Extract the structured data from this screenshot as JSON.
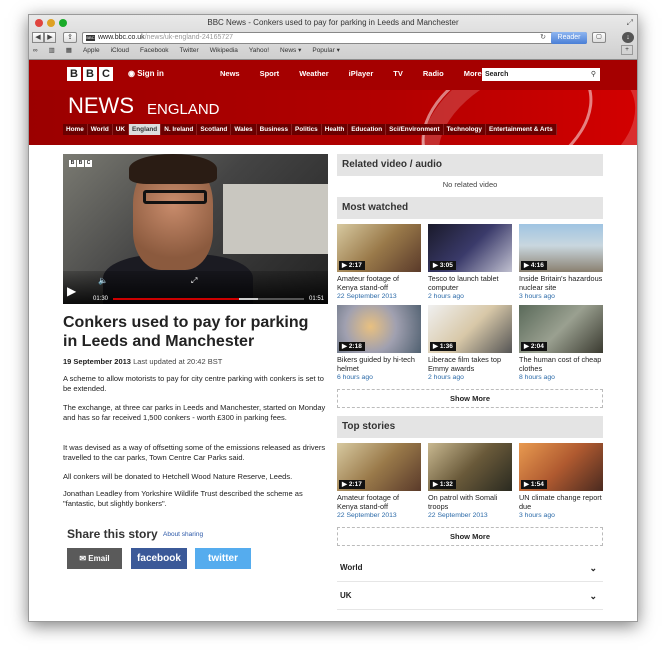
{
  "window": {
    "title": "BBC News - Conkers used to pay for parking in Leeds and Manchester"
  },
  "browser": {
    "url_main": "www.bbc.co.uk",
    "url_path": "/news/uk-england-24165727",
    "reader": "Reader",
    "bookmarks": [
      "Apple",
      "iCloud",
      "Facebook",
      "Twitter",
      "Wikipedia",
      "Yahoo!",
      "News ▾",
      "Popular ▾"
    ]
  },
  "bbc": {
    "logo": [
      "B",
      "B",
      "C"
    ],
    "sign_in": "Sign in",
    "top_nav": [
      "News",
      "Sport",
      "Weather",
      "iPlayer",
      "TV",
      "Radio",
      "More..."
    ],
    "search_placeholder": "Search"
  },
  "banner": {
    "news": "NEWS",
    "region": "ENGLAND"
  },
  "category_nav": [
    "Home",
    "World",
    "UK",
    "England",
    "N. Ireland",
    "Scotland",
    "Wales",
    "Business",
    "Politics",
    "Health",
    "Education",
    "Sci/Environment",
    "Technology",
    "Entertainment & Arts"
  ],
  "video": {
    "elapsed": "01:30",
    "duration": "01:51",
    "progress": 0.66
  },
  "article": {
    "headline": "Conkers used to pay for parking in Leeds and Manchester",
    "date": "19 September 2013",
    "updated": "Last updated at 20:42 BST",
    "paragraphs": [
      "A scheme to allow motorists to pay for city centre parking with conkers is set to be extended.",
      "The exchange, at three car parks in Leeds and Manchester, started on Monday and has so far received 1,500 conkers - worth £300 in parking fees.",
      "It was devised as a way of offsetting some of the emissions released as drivers travelled to the car parks, Town Centre Car Parks said.",
      "All conkers will be donated to Hetchell Wood Nature Reserve, Leeds.",
      "Jonathan Leadley from Yorkshire Wildlife Trust described the scheme as \"fantastic, but slightly bonkers\"."
    ]
  },
  "share": {
    "heading": "Share this story",
    "about": "About sharing",
    "email": "Email",
    "facebook": "facebook",
    "twitter": "twitter"
  },
  "related": {
    "heading": "Related video / audio",
    "empty": "No related video"
  },
  "most_watched": {
    "heading": "Most watched",
    "items": [
      {
        "duration": "2:17",
        "title": "Amateur footage of Kenya stand-off",
        "date": "22 September 2013"
      },
      {
        "duration": "3:05",
        "title": "Tesco to launch tablet computer",
        "date": "2 hours ago"
      },
      {
        "duration": "4:16",
        "title": "Inside Britain's hazardous nuclear site",
        "date": "3 hours ago"
      },
      {
        "duration": "2:18",
        "title": "Bikers guided by hi-tech helmet",
        "date": "6 hours ago"
      },
      {
        "duration": "1:36",
        "title": "Liberace film takes top Emmy awards",
        "date": "2 hours ago"
      },
      {
        "duration": "2:04",
        "title": "The human cost of cheap clothes",
        "date": "8 hours ago"
      }
    ],
    "show_more": "Show More"
  },
  "top_stories": {
    "heading": "Top stories",
    "items": [
      {
        "duration": "2:17",
        "title": "Amateur footage of Kenya stand-off",
        "date": "22 September 2013"
      },
      {
        "duration": "1:32",
        "title": "On patrol with Somali troops",
        "date": "22 September 2013"
      },
      {
        "duration": "1:54",
        "title": "UN climate change report due",
        "date": "3 hours ago"
      }
    ],
    "show_more": "Show More"
  },
  "accordion": [
    "World",
    "UK"
  ]
}
